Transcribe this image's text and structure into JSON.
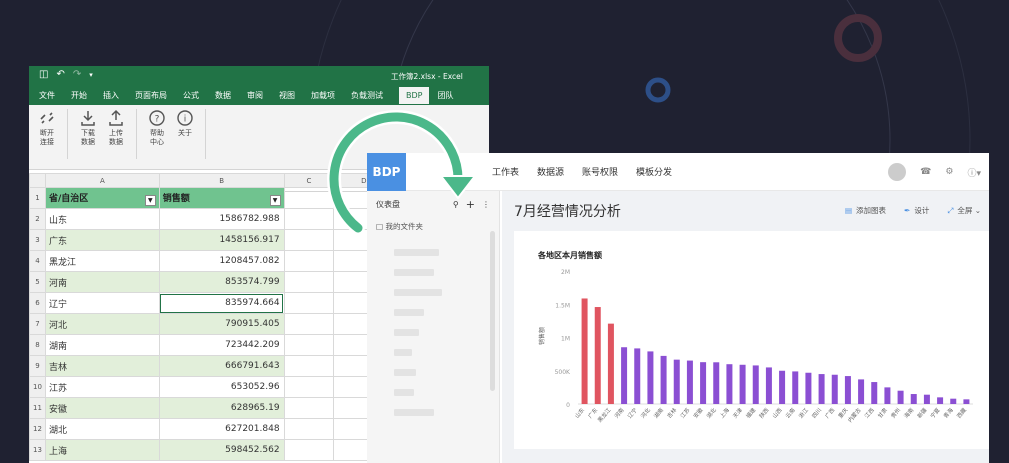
{
  "excel": {
    "window_title": "工作簿2.xlsx - Excel",
    "menu": [
      "文件",
      "开始",
      "插入",
      "页面布局",
      "公式",
      "数据",
      "审阅",
      "视图",
      "加载项",
      "负载测试",
      "BDP",
      "团队"
    ],
    "active_tab": "BDP",
    "ribbon": [
      {
        "label": "断开连接",
        "icon": "unlink-icon"
      },
      {
        "label": "下载数据",
        "icon": "download-icon"
      },
      {
        "label": "上传数据",
        "icon": "upload-icon"
      },
      {
        "label": "帮助中心",
        "icon": "help-icon"
      },
      {
        "label": "关于",
        "icon": "info-icon"
      }
    ],
    "columns": [
      "A",
      "B",
      "C",
      "D"
    ],
    "header": {
      "a": "省/自治区",
      "b": "销售额"
    },
    "rows": [
      {
        "n": "2",
        "a": "山东",
        "b": "1586782.988"
      },
      {
        "n": "3",
        "a": "广东",
        "b": "1458156.917"
      },
      {
        "n": "4",
        "a": "黑龙江",
        "b": "1208457.082"
      },
      {
        "n": "5",
        "a": "河南",
        "b": "853574.799"
      },
      {
        "n": "6",
        "a": "辽宁",
        "b": "835974.664"
      },
      {
        "n": "7",
        "a": "河北",
        "b": "790915.405"
      },
      {
        "n": "8",
        "a": "湖南",
        "b": "723442.209"
      },
      {
        "n": "9",
        "a": "吉林",
        "b": "666791.643"
      },
      {
        "n": "10",
        "a": "江苏",
        "b": "653052.96"
      },
      {
        "n": "11",
        "a": "安徽",
        "b": "628965.19"
      },
      {
        "n": "12",
        "a": "湖北",
        "b": "627201.848"
      },
      {
        "n": "13",
        "a": "上海",
        "b": "598452.562"
      }
    ]
  },
  "bdp": {
    "logo": "BDP",
    "nav": [
      "工作表",
      "数据源",
      "账号权限",
      "模板分发"
    ],
    "sidebar": {
      "title": "仪表盘",
      "folder": "我的文件夹"
    },
    "page_title": "7月经营情况分析",
    "actions": [
      "添加图表",
      "设计",
      "全屏"
    ]
  },
  "chart_data": {
    "type": "bar",
    "title": "各地区本月销售额",
    "ylabel": "销售额",
    "ylim": [
      0,
      2000000
    ],
    "yticks": [
      "0",
      "500K",
      "1M",
      "1.5M",
      "2M"
    ],
    "categories": [
      "山东",
      "广东",
      "黑龙江",
      "河南",
      "辽宁",
      "河北",
      "湖南",
      "吉林",
      "江苏",
      "安徽",
      "湖北",
      "上海",
      "天津",
      "福建",
      "陕西",
      "山西",
      "云南",
      "浙江",
      "四川",
      "广西",
      "重庆",
      "内蒙古",
      "江西",
      "甘肃",
      "贵州",
      "海南",
      "新疆",
      "宁夏",
      "青海",
      "西藏"
    ],
    "values": [
      1586783,
      1458157,
      1208457,
      853575,
      835975,
      790915,
      723442,
      666792,
      653053,
      628965,
      627202,
      598453,
      590000,
      580000,
      550000,
      500000,
      490000,
      470000,
      450000,
      440000,
      420000,
      370000,
      330000,
      250000,
      200000,
      150000,
      140000,
      100000,
      80000,
      70000
    ],
    "colors": {
      "top3": "#e05560",
      "rest": "#8b4fd3"
    }
  }
}
